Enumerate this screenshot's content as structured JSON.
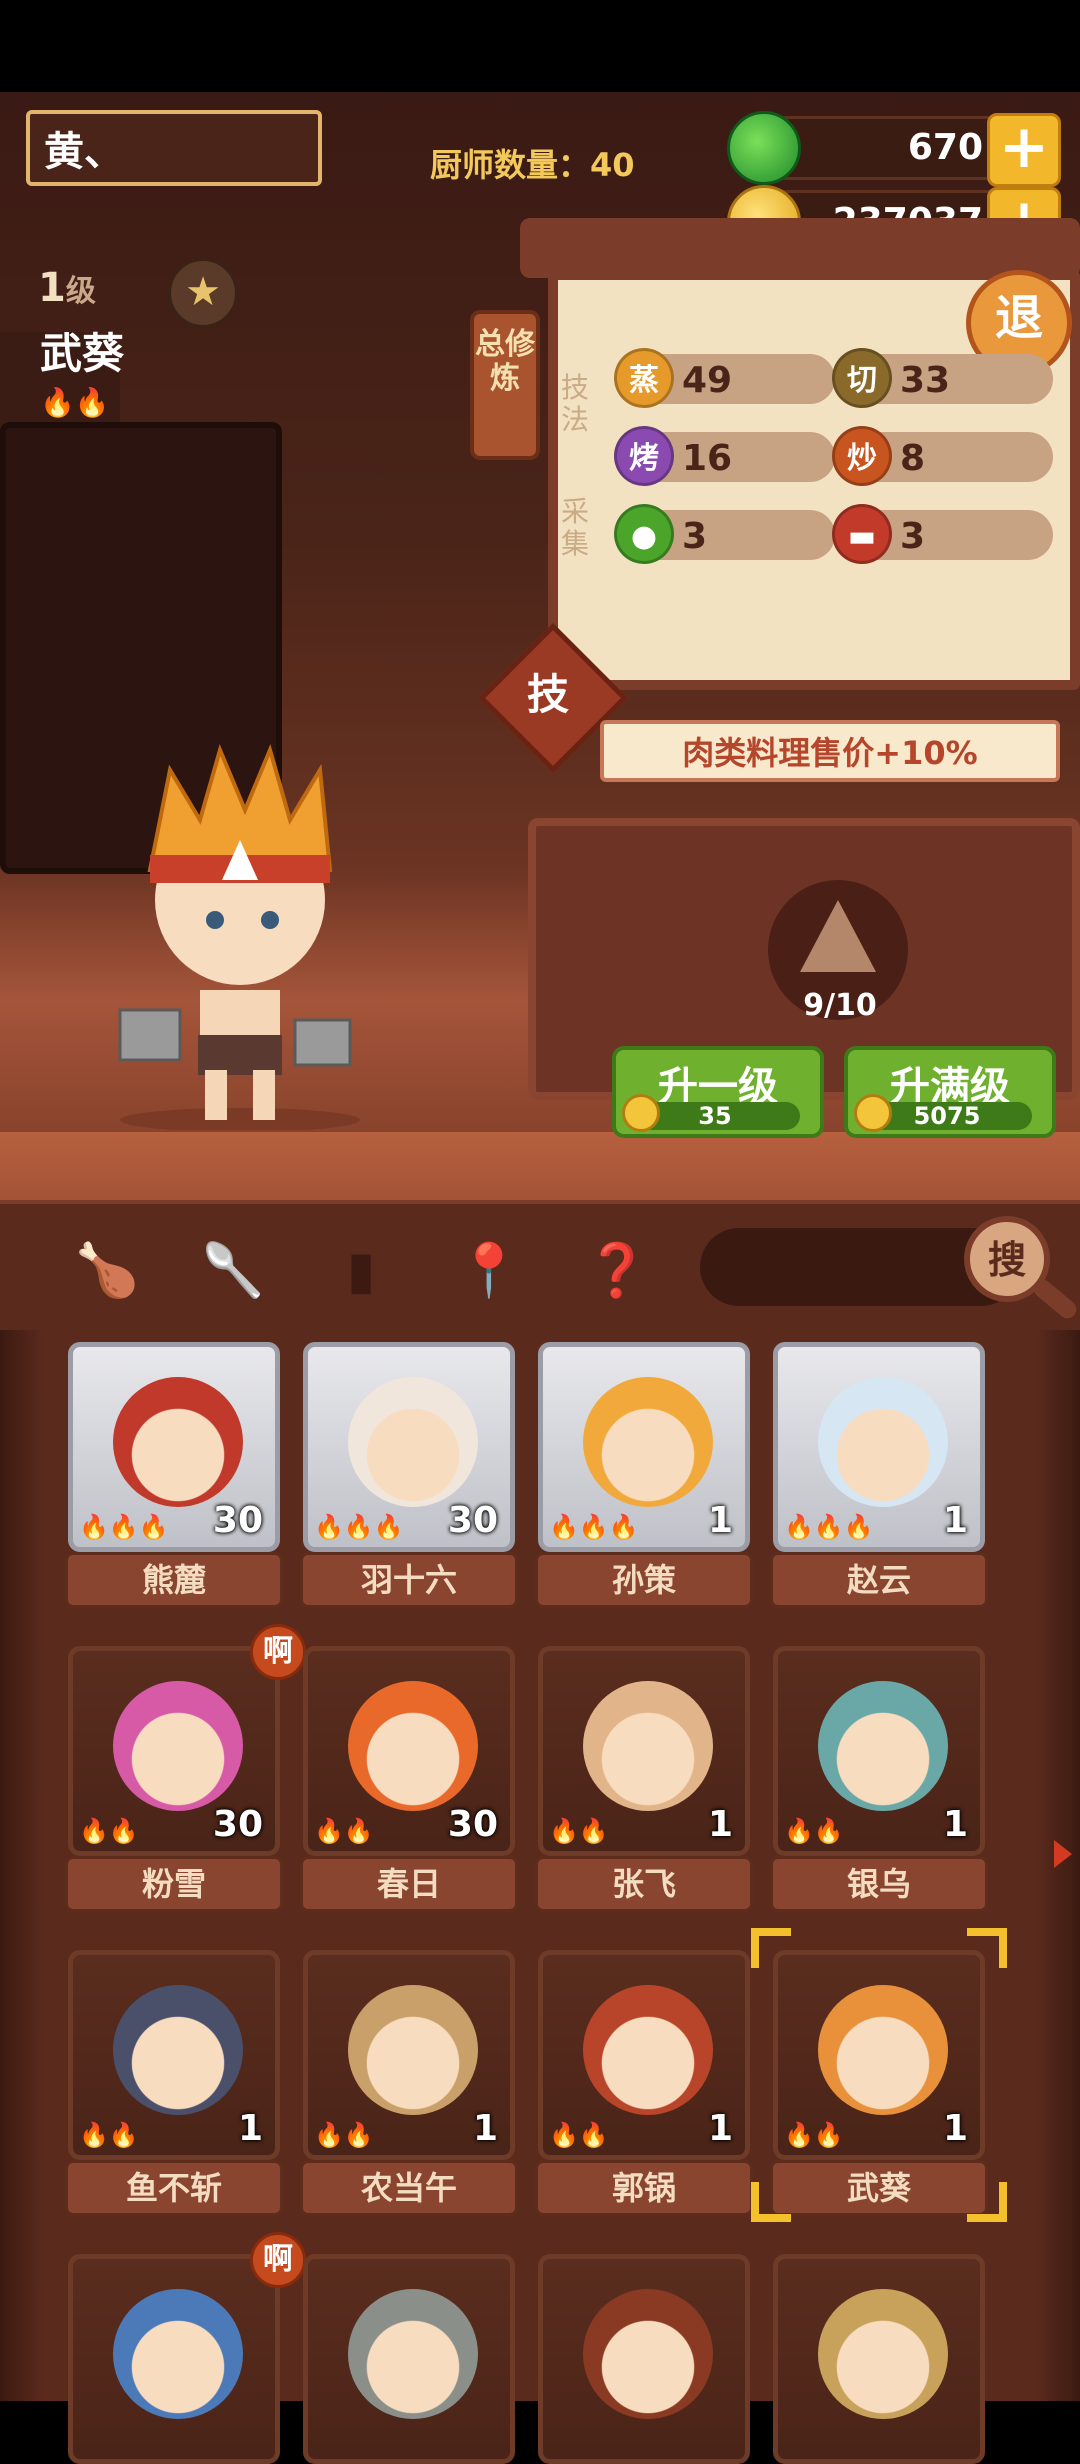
{
  "header": {
    "player_name": "黄、",
    "chef_count_label": "厨师数量：40",
    "jade": "670",
    "coins": "237037"
  },
  "chef": {
    "level_num": "1",
    "level_suffix": "级",
    "name": "武葵",
    "flames": "🔥🔥"
  },
  "panel": {
    "side_tab": "总修炼",
    "exit_label": "退",
    "skill_label": "技法",
    "gather_label": "采集",
    "skills": [
      {
        "icon": "蒸",
        "value": "49",
        "color": "#e59a2b"
      },
      {
        "icon": "切",
        "value": "33",
        "color": "#8a6a2a"
      },
      {
        "icon": "烤",
        "value": "16",
        "color": "#8b4ab0"
      },
      {
        "icon": "炒",
        "value": "8",
        "color": "#c8551f"
      }
    ],
    "gather": [
      {
        "icon": "cabbage-icon",
        "value": "3",
        "color": "#4aa52a"
      },
      {
        "icon": "meat-icon",
        "value": "3",
        "color": "#c23a2a"
      }
    ],
    "ji_badge": "技",
    "bonus": "肉类料理售价+10%",
    "book_count": "9/10",
    "upgrade_one": {
      "label": "升一级",
      "cost": "35"
    },
    "upgrade_max": {
      "label": "升满级",
      "cost": "5075"
    }
  },
  "toolbar": {
    "icons": [
      "meat-leg-icon",
      "shovel-icon",
      "jar-icon",
      "location-icon",
      "question-map-icon"
    ],
    "search_label": "搜"
  },
  "roster": [
    {
      "name": "熊麓",
      "level": "30",
      "flames": "🔥🔥🔥",
      "style": "gold",
      "face": "#c0392b"
    },
    {
      "name": "羽十六",
      "level": "30",
      "flames": "🔥🔥🔥",
      "style": "gold",
      "face": "#f0e6dc"
    },
    {
      "name": "孙策",
      "level": "1",
      "flames": "🔥🔥🔥",
      "style": "gold",
      "face": "#f2a93b"
    },
    {
      "name": "赵云",
      "level": "1",
      "flames": "🔥🔥🔥",
      "style": "gold",
      "face": "#d6e6f2"
    },
    {
      "name": "粉雪",
      "level": "30",
      "flames": "🔥🔥",
      "style": "plain",
      "face": "#d65aa6",
      "badge": "啊"
    },
    {
      "name": "春日",
      "level": "30",
      "flames": "🔥🔥",
      "style": "plain",
      "face": "#e8692a"
    },
    {
      "name": "张飞",
      "level": "1",
      "flames": "🔥🔥",
      "style": "plain",
      "face": "#e2b48a"
    },
    {
      "name": "银乌",
      "level": "1",
      "flames": "🔥🔥",
      "style": "plain",
      "face": "#6aa8a8"
    },
    {
      "name": "鱼不斩",
      "level": "1",
      "flames": "🔥🔥",
      "style": "plain",
      "face": "#4a4f6a"
    },
    {
      "name": "农当午",
      "level": "1",
      "flames": "🔥🔥",
      "style": "plain",
      "face": "#caa06a"
    },
    {
      "name": "郭锅",
      "level": "1",
      "flames": "🔥🔥",
      "style": "plain",
      "face": "#b8442a"
    },
    {
      "name": "武葵",
      "level": "1",
      "flames": "🔥🔥",
      "style": "plain",
      "face": "#e8913a",
      "selected": true
    },
    {
      "name": "",
      "level": "",
      "flames": "",
      "style": "plain",
      "face": "#4c7ab8",
      "badge": "啊"
    },
    {
      "name": "",
      "level": "",
      "flames": "",
      "style": "plain",
      "face": "#8b8f8a"
    },
    {
      "name": "",
      "level": "",
      "flames": "",
      "style": "plain",
      "face": "#8a3a22"
    },
    {
      "name": "",
      "level": "",
      "flames": "",
      "style": "plain",
      "face": "#c8a25a"
    }
  ]
}
